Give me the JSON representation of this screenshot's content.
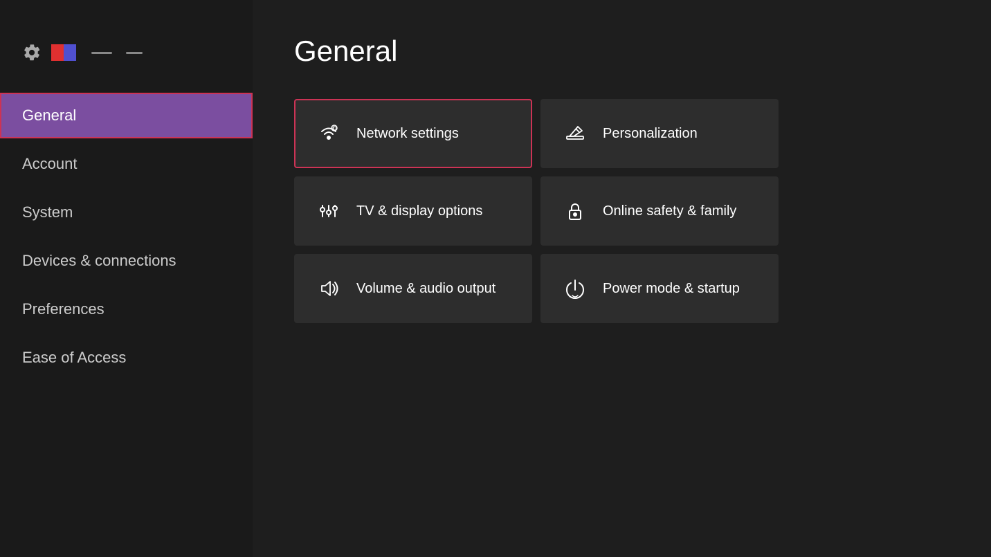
{
  "header": {
    "title": "General"
  },
  "sidebar": {
    "items": [
      {
        "id": "general",
        "label": "General",
        "active": true
      },
      {
        "id": "account",
        "label": "Account",
        "active": false
      },
      {
        "id": "system",
        "label": "System",
        "active": false
      },
      {
        "id": "devices-connections",
        "label": "Devices & connections",
        "active": false
      },
      {
        "id": "preferences",
        "label": "Preferences",
        "active": false
      },
      {
        "id": "ease-of-access",
        "label": "Ease of Access",
        "active": false
      }
    ]
  },
  "grid": {
    "items": [
      {
        "id": "network-settings",
        "label": "Network settings",
        "icon": "network-icon",
        "highlighted": true
      },
      {
        "id": "personalization",
        "label": "Personalization",
        "icon": "personalization-icon",
        "highlighted": false
      },
      {
        "id": "tv-display",
        "label": "TV & display options",
        "icon": "tv-display-icon",
        "highlighted": false
      },
      {
        "id": "online-safety",
        "label": "Online safety & family",
        "icon": "lock-icon",
        "highlighted": false
      },
      {
        "id": "volume-audio",
        "label": "Volume & audio output",
        "icon": "volume-icon",
        "highlighted": false
      },
      {
        "id": "power-mode",
        "label": "Power mode & startup",
        "icon": "power-icon",
        "highlighted": false
      }
    ]
  }
}
